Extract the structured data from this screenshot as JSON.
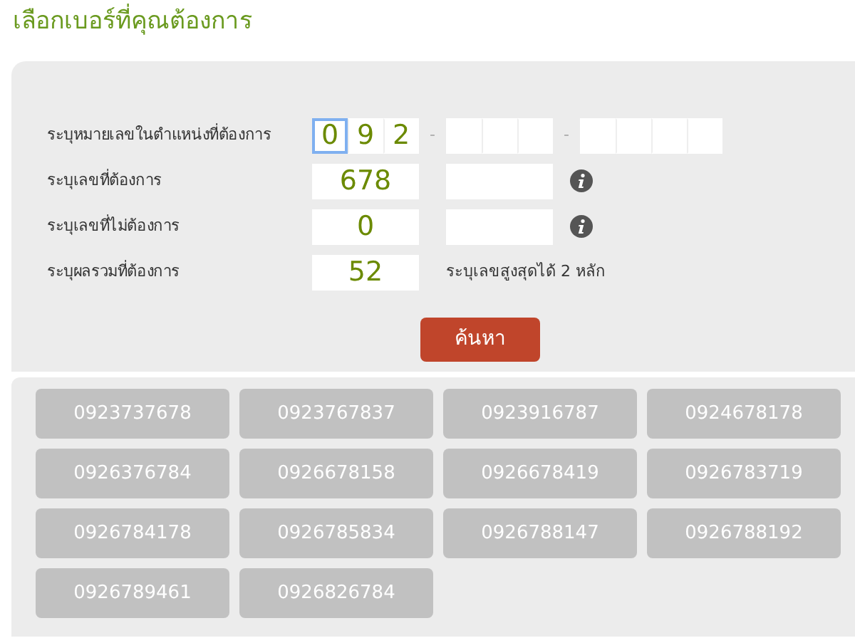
{
  "title": "เลือกเบอร์ที่คุณต้องการ",
  "filters": [
    {
      "kind": "digits",
      "label": "ระบุหมายเลขในตำแหน่งที่ต้องการ",
      "groups": [
        [
          {
            "value": "0",
            "focused": true
          },
          {
            "value": "9",
            "focused": false
          },
          {
            "value": "2",
            "focused": false
          }
        ],
        [
          {
            "focused": false
          },
          {
            "focused": false
          },
          {
            "focused": false
          }
        ],
        [
          {
            "focused": false
          },
          {
            "focused": false
          },
          {
            "focused": false
          },
          {
            "focused": false
          }
        ]
      ],
      "separator": "-"
    },
    {
      "kind": "pair",
      "label": "ระบุเลขที่ต้องการ",
      "value": "678",
      "info": true
    },
    {
      "kind": "pair",
      "label": "ระบุเลขที่ไม่ต้องการ",
      "value": "0",
      "info": true
    },
    {
      "kind": "note",
      "label": "ระบุผลรวมที่ต้องการ",
      "value": "52",
      "note": "ระบุเลขสูงสุดได้ 2 หลัก"
    }
  ],
  "search_button": "ค้นหา",
  "results": [
    "0923737678",
    "0923767837",
    "0923916787",
    "0924678178",
    "0926376784",
    "0926678158",
    "0926678419",
    "0926783719",
    "0926784178",
    "0926785834",
    "0926788147",
    "0926788192",
    "0926789461",
    "0926826784"
  ]
}
